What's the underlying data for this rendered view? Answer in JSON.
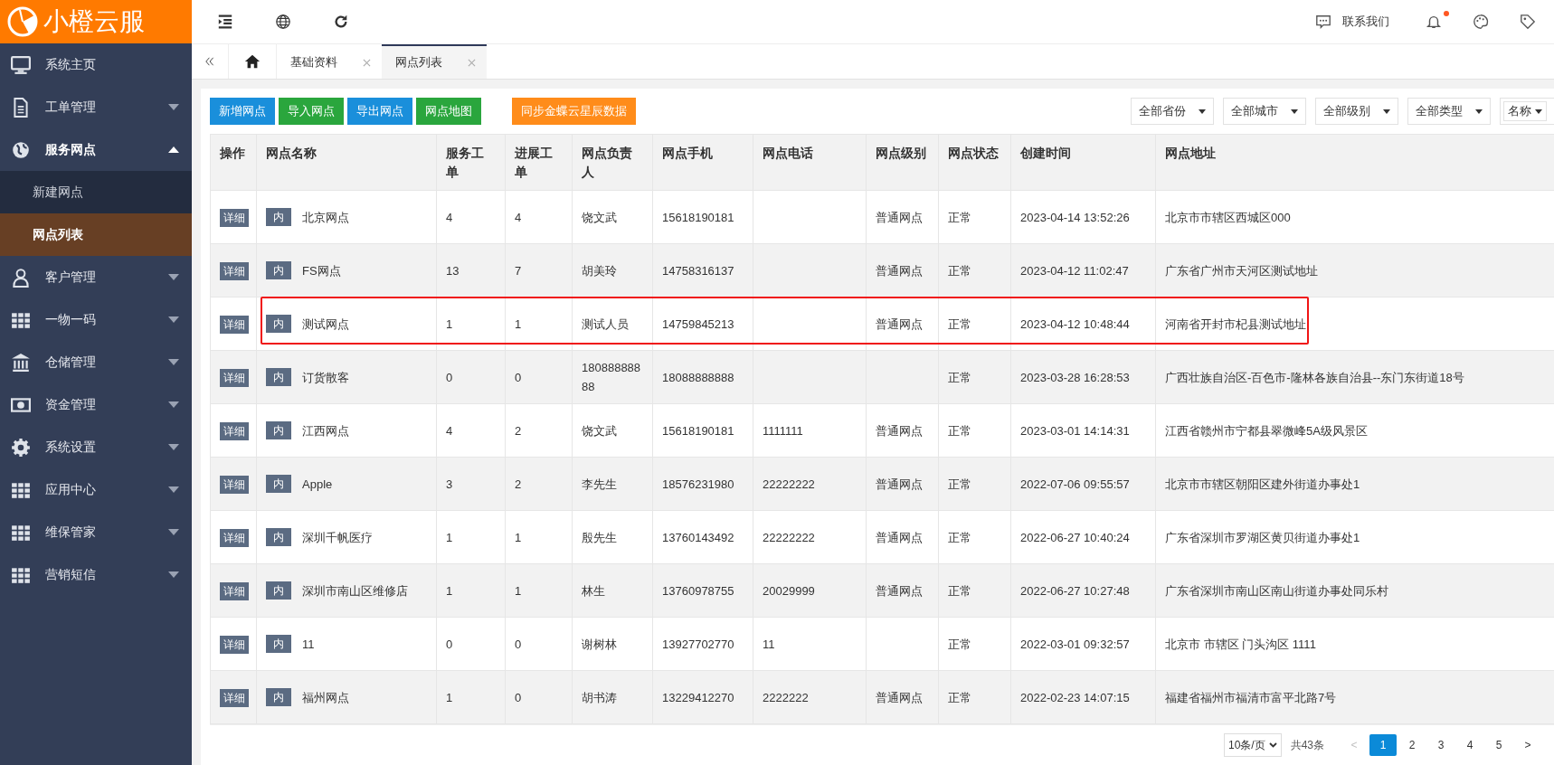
{
  "logo": {
    "text": "小橙云服"
  },
  "sidebar": {
    "items": [
      {
        "label": "系统主页",
        "expandable": false,
        "expanded": false
      },
      {
        "label": "工单管理",
        "expandable": true,
        "expanded": false
      },
      {
        "label": "服务网点",
        "expandable": true,
        "expanded": true,
        "children": [
          {
            "label": "新建网点",
            "selected": false
          },
          {
            "label": "网点列表",
            "selected": true
          }
        ]
      },
      {
        "label": "客户管理",
        "expandable": true,
        "expanded": false
      },
      {
        "label": "一物一码",
        "expandable": true,
        "expanded": false
      },
      {
        "label": "仓储管理",
        "expandable": true,
        "expanded": false
      },
      {
        "label": "资金管理",
        "expandable": true,
        "expanded": false
      },
      {
        "label": "系统设置",
        "expandable": true,
        "expanded": false
      },
      {
        "label": "应用中心",
        "expandable": true,
        "expanded": false
      },
      {
        "label": "维保管家",
        "expandable": true,
        "expanded": false
      },
      {
        "label": "营销短信",
        "expandable": true,
        "expanded": false
      }
    ]
  },
  "topbar": {
    "contact": "联系我们",
    "notification_dot": true
  },
  "tabs": [
    {
      "label": "基础资料",
      "selected": false
    },
    {
      "label": "网点列表",
      "selected": true
    }
  ],
  "actions": [
    {
      "label": "新增网点",
      "color": "#1a8fdb"
    },
    {
      "label": "导入网点",
      "color": "#2aa63d"
    },
    {
      "label": "导出网点",
      "color": "#1a8fdb"
    },
    {
      "label": "网点地图",
      "color": "#2aa63d"
    },
    {
      "label": "同步金蝶云星辰数据",
      "color": "#ff8c1a"
    }
  ],
  "filters": [
    "全部省份",
    "全部城市",
    "全部级别",
    "全部类型"
  ],
  "search": {
    "field": "名称"
  },
  "table": {
    "columns": [
      "操作",
      "网点名称",
      "服务工单",
      "进展工单",
      "网点负责人",
      "网点手机",
      "网点电话",
      "网点级别",
      "网点状态",
      "创建时间",
      "网点地址"
    ],
    "rows": [
      {
        "detail": "详细",
        "tag": "内",
        "name": "北京网点",
        "service": "4",
        "progress": "4",
        "manager": "饶文武",
        "mobile": "15618190181",
        "phone": "",
        "level": "普通网点",
        "status": "正常",
        "created": "2023-04-14 13:52:26",
        "address": "北京市市辖区西城区000",
        "highlighted": false
      },
      {
        "detail": "详细",
        "tag": "内",
        "name": "FS网点",
        "service": "13",
        "progress": "7",
        "manager": "胡美玲",
        "mobile": "14758316137",
        "phone": "",
        "level": "普通网点",
        "status": "正常",
        "created": "2023-04-12 11:02:47",
        "address": "广东省广州市天河区测试地址",
        "highlighted": false
      },
      {
        "detail": "详细",
        "tag": "内",
        "name": "测试网点",
        "service": "1",
        "progress": "1",
        "manager": "测试人员",
        "mobile": "14759845213",
        "phone": "",
        "level": "普通网点",
        "status": "正常",
        "created": "2023-04-12 10:48:44",
        "address": "河南省开封市杞县测试地址",
        "highlighted": true
      },
      {
        "detail": "详细",
        "tag": "内",
        "name": "订货散客",
        "service": "0",
        "progress": "0",
        "manager": "18088888888",
        "mobile": "18088888888",
        "phone": "",
        "level": "",
        "status": "正常",
        "created": "2023-03-28 16:28:53",
        "address": "广西壮族自治区-百色市-隆林各族自治县--东门东街道18号",
        "highlighted": false
      },
      {
        "detail": "详细",
        "tag": "内",
        "name": "江西网点",
        "service": "4",
        "progress": "2",
        "manager": "饶文武",
        "mobile": "15618190181",
        "phone": "1111111",
        "level": "普通网点",
        "status": "正常",
        "created": "2023-03-01 14:14:31",
        "address": "江西省赣州市宁都县翠微峰5A级风景区",
        "highlighted": false
      },
      {
        "detail": "详细",
        "tag": "内",
        "name": "Apple",
        "service": "3",
        "progress": "2",
        "manager": "李先生",
        "mobile": "18576231980",
        "phone": "22222222",
        "level": "普通网点",
        "status": "正常",
        "created": "2022-07-06 09:55:57",
        "address": "北京市市辖区朝阳区建外街道办事处1",
        "highlighted": false
      },
      {
        "detail": "详细",
        "tag": "内",
        "name": "深圳千帆医疗",
        "service": "1",
        "progress": "1",
        "manager": "殷先生",
        "mobile": "13760143492",
        "phone": "22222222",
        "level": "普通网点",
        "status": "正常",
        "created": "2022-06-27 10:40:24",
        "address": "广东省深圳市罗湖区黄贝街道办事处1",
        "highlighted": false
      },
      {
        "detail": "详细",
        "tag": "内",
        "name": "深圳市南山区维修店",
        "service": "1",
        "progress": "1",
        "manager": "林生",
        "mobile": "13760978755",
        "phone": "20029999",
        "level": "普通网点",
        "status": "正常",
        "created": "2022-06-27 10:27:48",
        "address": "广东省深圳市南山区南山街道办事处同乐村",
        "highlighted": false
      },
      {
        "detail": "详细",
        "tag": "内",
        "name": "11",
        "service": "0",
        "progress": "0",
        "manager": "谢树林",
        "mobile": "13927702770",
        "phone": "11",
        "level": "",
        "status": "正常",
        "created": "2022-03-01 09:32:57",
        "address": "北京市 市辖区 门头沟区 1111",
        "highlighted": false
      },
      {
        "detail": "详细",
        "tag": "内",
        "name": "福州网点",
        "service": "1",
        "progress": "0",
        "manager": "胡书涛",
        "mobile": "13229412270",
        "phone": "2222222",
        "level": "普通网点",
        "status": "正常",
        "created": "2022-02-23 14:07:15",
        "address": "福建省福州市福清市富平北路7号",
        "highlighted": false
      }
    ]
  },
  "pagination": {
    "page_size": "10条/页",
    "total": "共43条",
    "prev": "<",
    "prev_disabled": true,
    "pages": [
      {
        "label": "1",
        "selected": true
      },
      {
        "label": "2",
        "selected": false
      },
      {
        "label": "3",
        "selected": false
      },
      {
        "label": "4",
        "selected": false
      },
      {
        "label": "5",
        "selected": false
      }
    ],
    "next": ">"
  }
}
